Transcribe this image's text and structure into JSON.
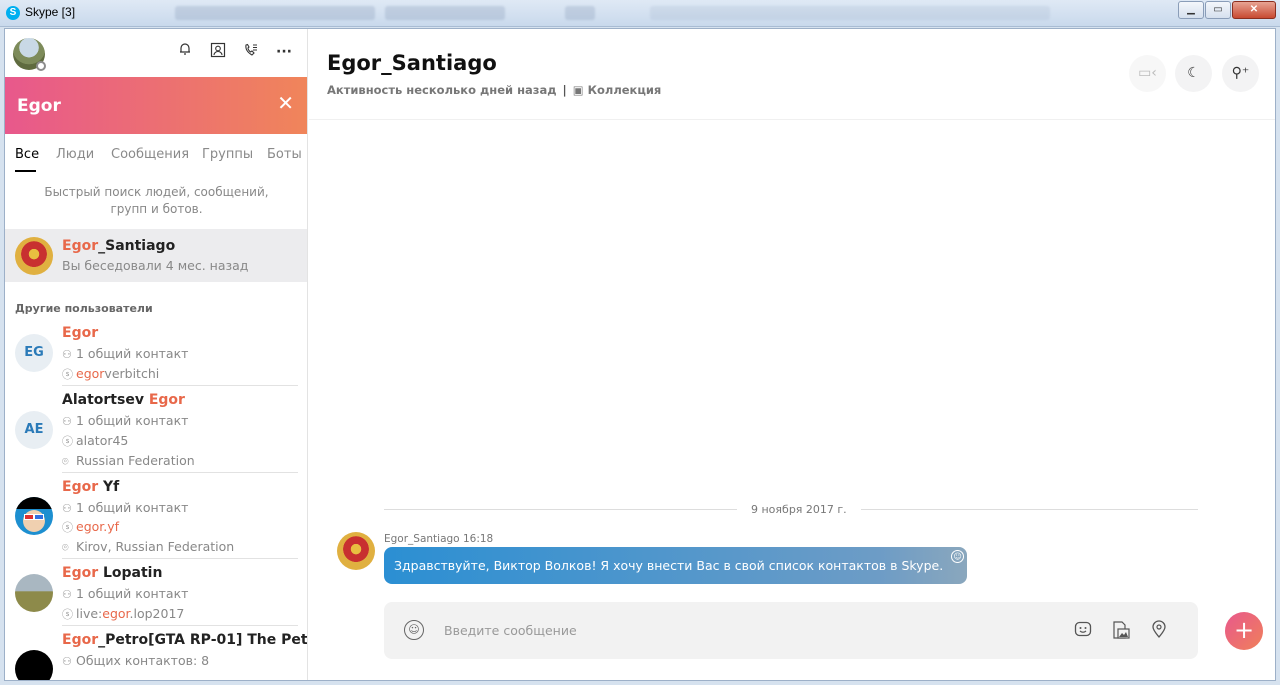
{
  "window": {
    "title": "Skype [3]"
  },
  "search": {
    "query": "Egor",
    "tabs": [
      "Все",
      "Люди",
      "Сообщения",
      "Группы",
      "Боты"
    ],
    "hint": "Быстрый поиск людей, сообщений, групп и ботов."
  },
  "top_result": {
    "name_hl": "Egor",
    "name_rest": "_Santiago",
    "sub": "Вы беседовали 4 мес. назад"
  },
  "others_label": "Другие пользователи",
  "others": [
    {
      "initials": "EG",
      "name_pre": "",
      "name_hl": "Egor",
      "name_rest": "",
      "contacts": "1 общий контакт",
      "skype_pre": "",
      "skype_hl": "egor",
      "skype_rest": "verbitchi",
      "location": ""
    },
    {
      "initials": "AE",
      "name_pre": "Alatortsev ",
      "name_hl": "Egor",
      "name_rest": "",
      "contacts": "1 общий контакт",
      "skype_pre": "",
      "skype_hl": "",
      "skype_rest": "alator45",
      "location": "Russian Federation"
    },
    {
      "initials": "",
      "name_pre": "",
      "name_hl": "Egor",
      "name_rest": " Yf",
      "contacts": "1 общий контакт",
      "skype_pre": "",
      "skype_hl": "egor",
      "skype_rest": ".yf",
      "location": "Kirov, Russian Federation"
    },
    {
      "initials": "",
      "name_pre": "",
      "name_hl": "Egor",
      "name_rest": " Lopatin",
      "contacts": "1 общий контакт",
      "skype_pre": "live:",
      "skype_hl": "egor",
      "skype_rest": ".lop2017",
      "location": ""
    },
    {
      "initials": "",
      "name_pre": "",
      "name_hl": "Egor",
      "name_rest": "_Petro[GTA RP-01] The Pet...",
      "contacts": "Общих контактов: 8",
      "skype_pre": "",
      "skype_hl": "",
      "skype_rest": "",
      "location": ""
    }
  ],
  "chat": {
    "title": "Egor_Santiago",
    "activity": "Активность несколько дней назад",
    "separator": "|",
    "collection": "Коллекция",
    "date": "9 ноября 2017 г.",
    "message": {
      "author": "Egor_Santiago",
      "time": "16:18",
      "text": "Здравствуйте, Виктор Волков! Я хочу внести Вас в свой список контактов в Skype."
    },
    "composer_placeholder": "Введите сообщение"
  },
  "colors": {
    "accent_gradient_start": "#e8588c",
    "accent_gradient_end": "#f0855a",
    "highlight": "#e8684a",
    "bubble": "#2b8fd3"
  },
  "icons": {
    "topbar": [
      "bell-icon",
      "contacts-icon",
      "call-icon",
      "more-icon"
    ],
    "header": [
      "video-call-icon",
      "moon-icon",
      "add-person-icon"
    ],
    "composer": [
      "emoji-icon",
      "sticker-icon",
      "media-icon",
      "location-icon",
      "plus-icon"
    ]
  }
}
